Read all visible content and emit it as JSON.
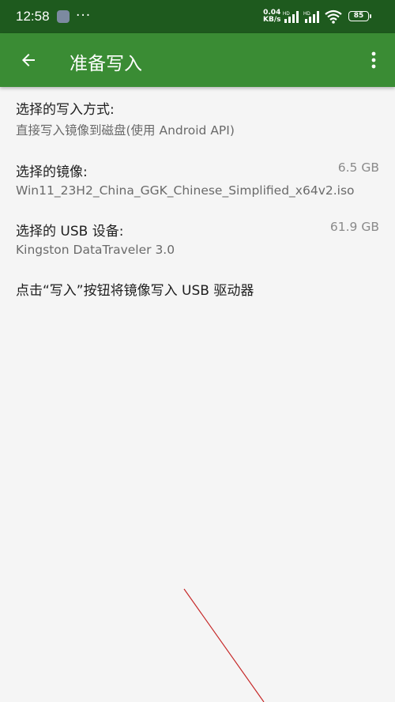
{
  "status_bar": {
    "time": "12:58",
    "more": "···",
    "speed_value": "0.04",
    "speed_unit": "KB/s",
    "net_type_1": "HD",
    "net_type_2": "HD",
    "battery": "85"
  },
  "app_bar": {
    "title": "准备写入"
  },
  "main": {
    "write_method_label": "选择的写入方式:",
    "write_method_value": "直接写入镜像到磁盘(使用 Android API)",
    "image_label": "选择的镜像:",
    "image_value": "Win11_23H2_China_GGK_Chinese_Simplified_x64v2.iso",
    "image_size": "6.5 GB",
    "usb_label": "选择的 USB 设备:",
    "usb_value": "Kingston DataTraveler 3.0",
    "usb_size": "61.9 GB",
    "instruction": "点击“写入”按钮将镜像写入 USB 驱动器"
  },
  "colors": {
    "status_bar_bg": "#1e5a1e",
    "app_bar_bg": "#3a8c34",
    "page_bg": "#f5f5f5",
    "pen_stroke": "#c62828"
  }
}
